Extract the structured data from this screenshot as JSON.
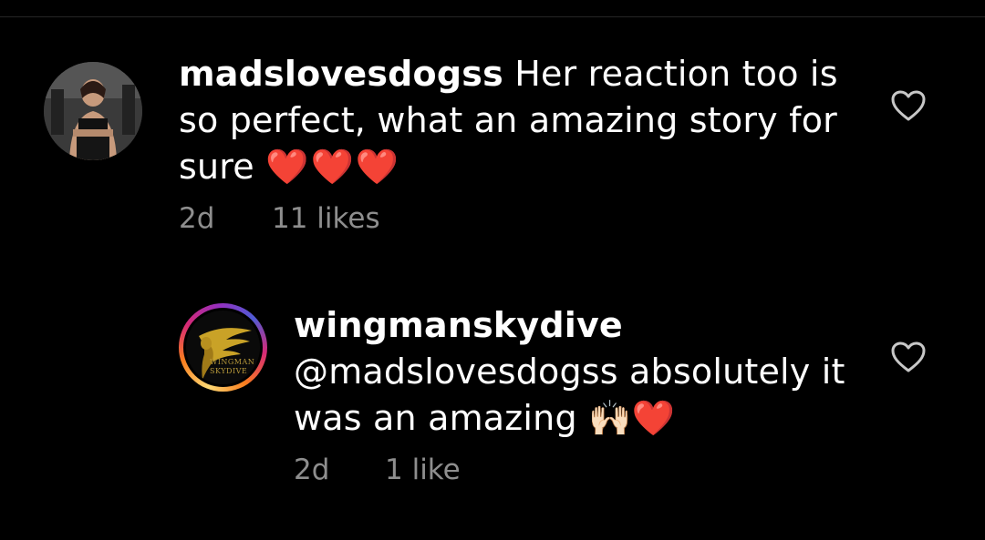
{
  "comments": [
    {
      "username": "madslovesdogss",
      "text": "Her reaction too is so perfect, what an amazing story for sure",
      "emoji": "❤️❤️❤️",
      "time": "2d",
      "likes": "11 likes"
    },
    {
      "username": "wingmanskydive",
      "text": "@madslovesdogss absolutely it was an amazing",
      "emoji": "🙌🏻❤️",
      "time": "2d",
      "likes": "1 like",
      "avatar_logo_text": "WINGMAN SKYDIVE"
    }
  ],
  "icons": {
    "like": "heart-outline-icon"
  },
  "colors": {
    "background": "#000000",
    "secondary_text": "#8e8e8e",
    "heart": "#e0142b"
  }
}
